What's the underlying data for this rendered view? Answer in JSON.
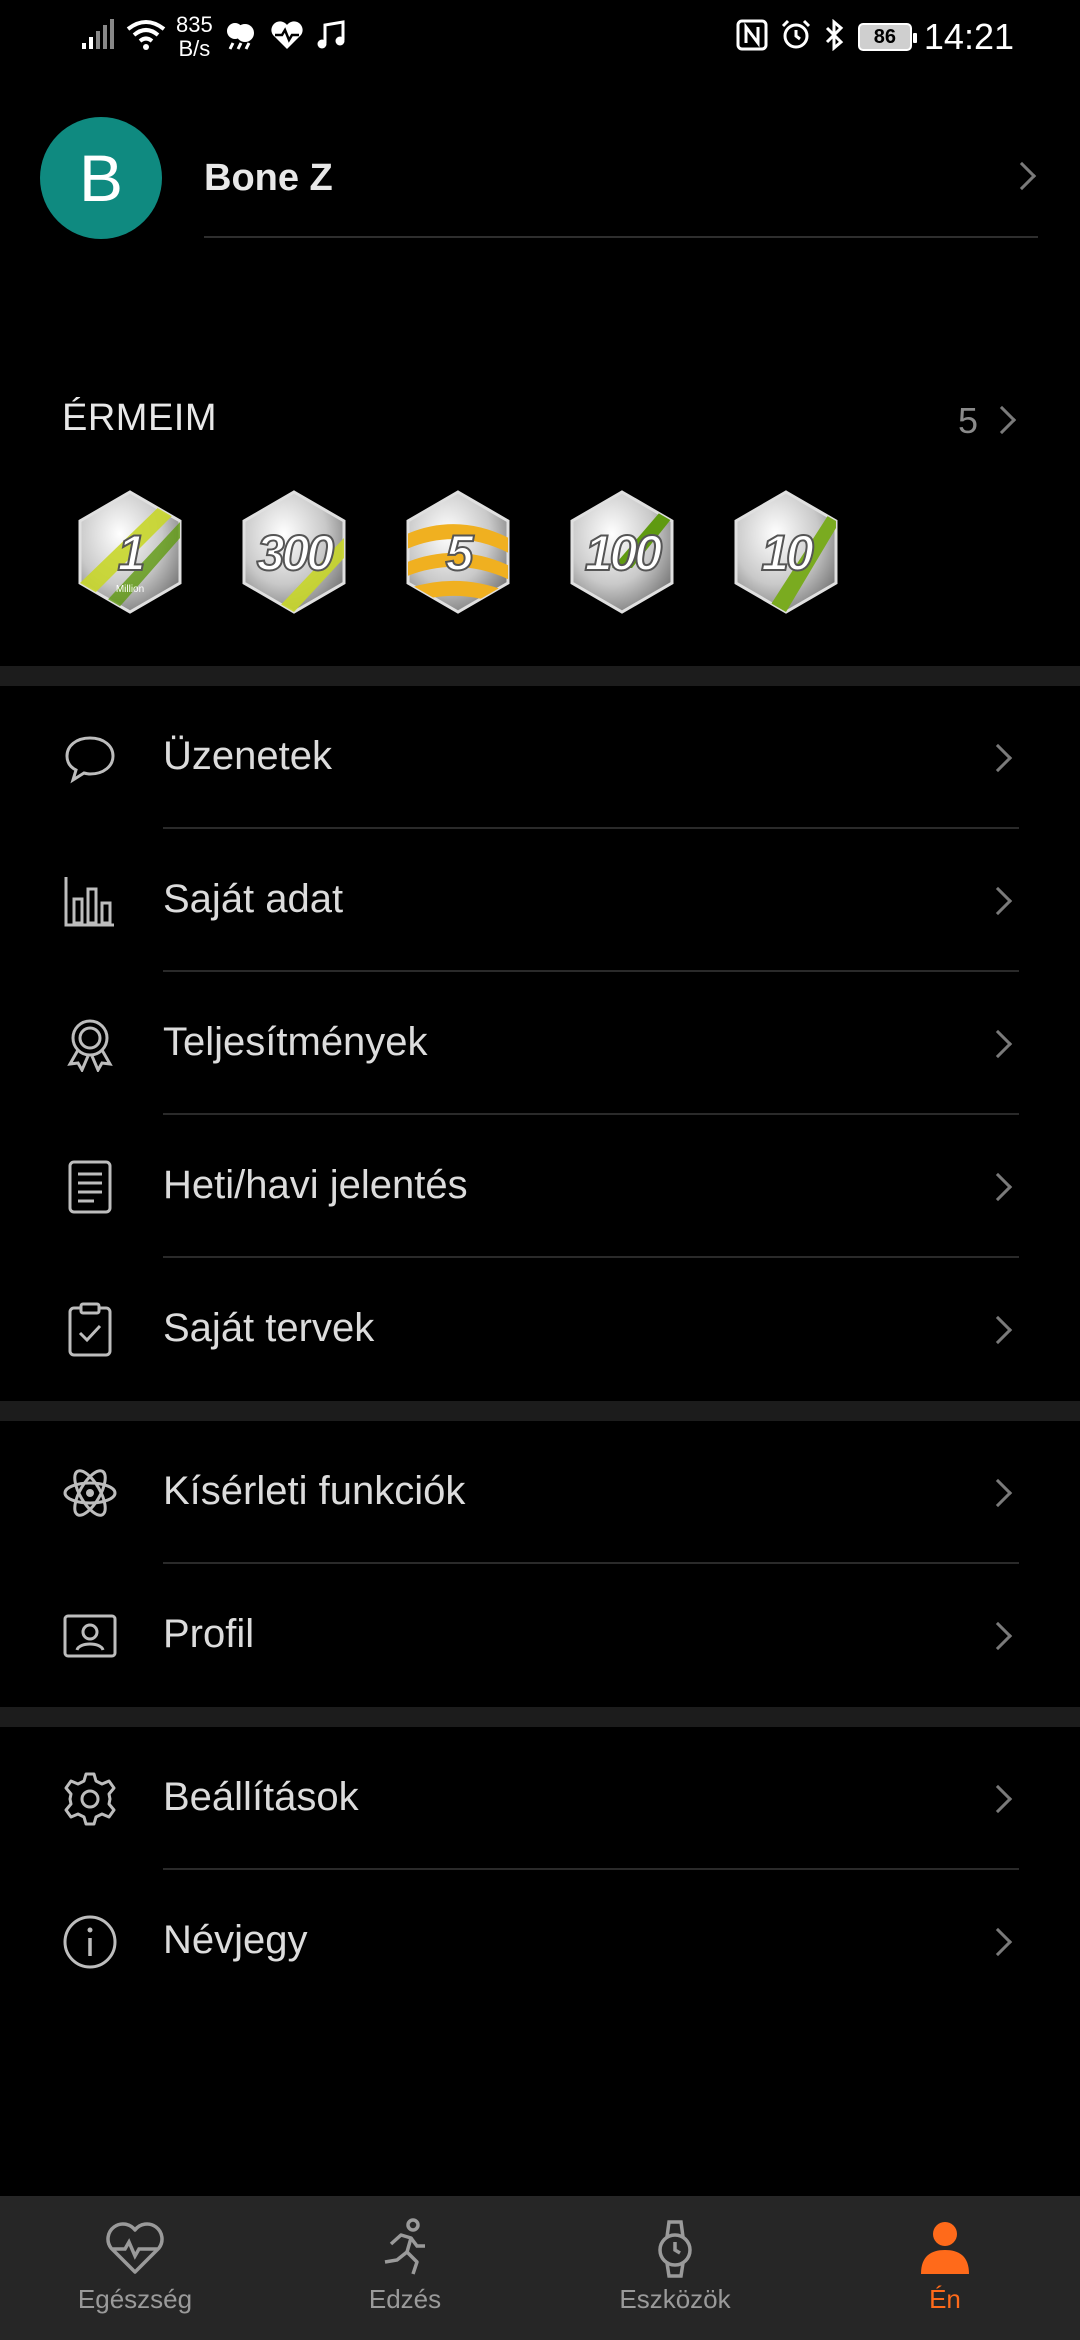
{
  "status_bar": {
    "net_speed_value": "835",
    "net_speed_unit": "B/s",
    "battery": "86",
    "time": "14:21",
    "icons": [
      "signal-icon",
      "wifi-icon",
      "weather-icon",
      "health-icon",
      "music-icon",
      "nfc-icon",
      "alarm-icon",
      "bluetooth-icon",
      "battery-icon"
    ]
  },
  "profile": {
    "avatar_letter": "B",
    "name": "Bone Z",
    "avatar_color": "#0f8a80"
  },
  "medals": {
    "title": "ÉRMEIM",
    "count": "5",
    "items": [
      {
        "number": "1",
        "sub": "Million",
        "stripe": "#c8d62a"
      },
      {
        "number": "300",
        "sub": "",
        "stripe": "#c8d62a"
      },
      {
        "number": "5",
        "sub": "",
        "stripe": "#f0b020"
      },
      {
        "number": "100",
        "sub": "",
        "stripe": "#5f9a10"
      },
      {
        "number": "10",
        "sub": "",
        "stripe": "#7aab20"
      }
    ]
  },
  "menu": {
    "messages": "Üzenetek",
    "my_data": "Saját adat",
    "achievements": "Teljesítmények",
    "reports": "Heti/havi jelentés",
    "plans": "Saját tervek",
    "experimental": "Kísérleti funkciók",
    "profile": "Profil",
    "settings": "Beállítások",
    "about": "Névjegy"
  },
  "bottom_nav": {
    "health": "Egészség",
    "workout": "Edzés",
    "devices": "Eszközök",
    "me": "Én",
    "active_color": "#ff6a1a"
  }
}
